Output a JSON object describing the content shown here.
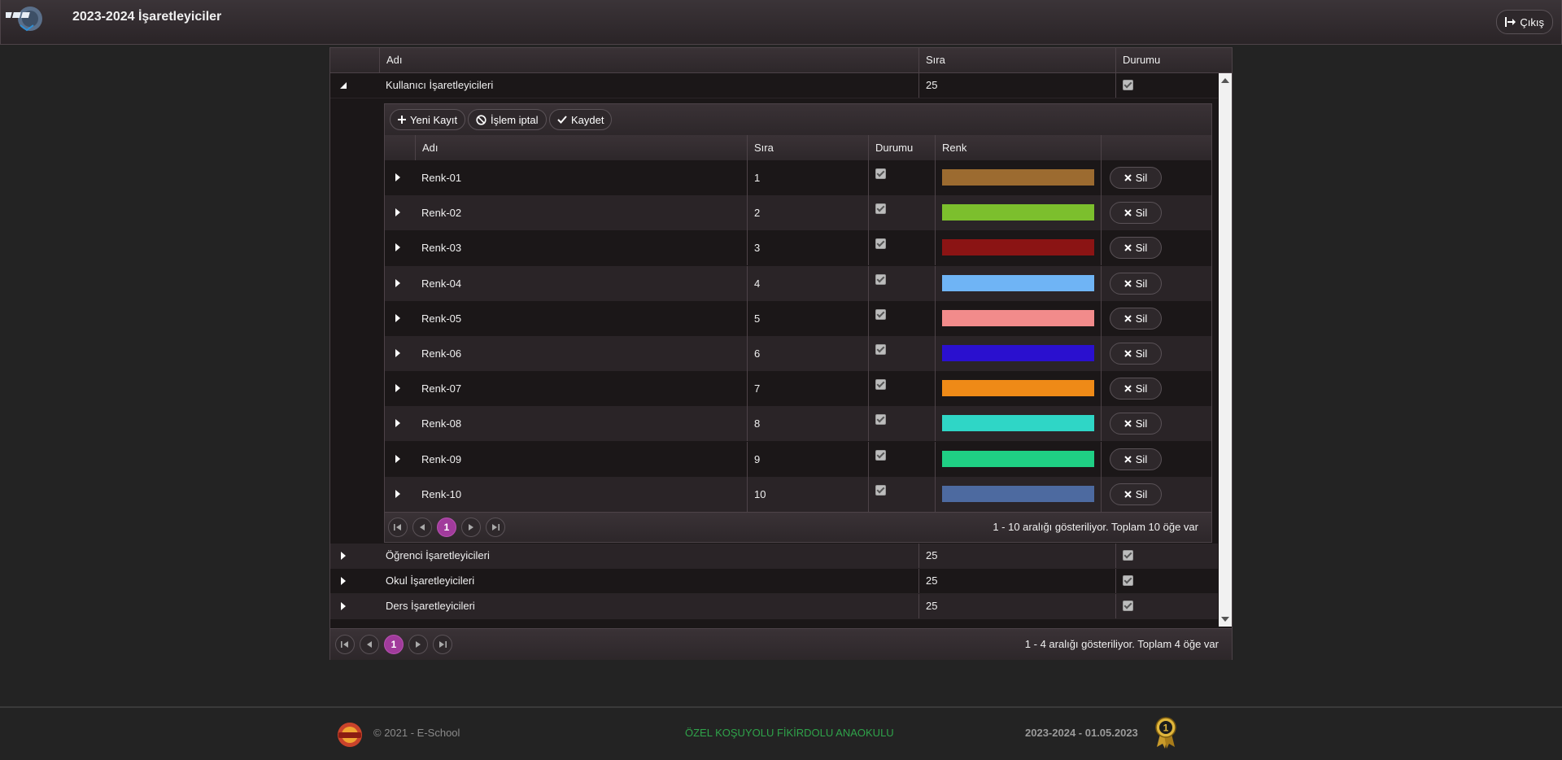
{
  "header": {
    "title": "2023-2024 İşaretleyiciler",
    "exit_label": "Çıkış"
  },
  "grid": {
    "columns": {
      "name": "Adı",
      "order": "Sıra",
      "status": "Durumu"
    },
    "rows": [
      {
        "name": "Kullanıcı İşaretleyicileri",
        "order": "25",
        "active": true,
        "expanded": true
      },
      {
        "name": "Öğrenci İşaretleyicileri",
        "order": "25",
        "active": true,
        "expanded": false
      },
      {
        "name": "Okul İşaretleyicileri",
        "order": "25",
        "active": true,
        "expanded": false
      },
      {
        "name": "Ders İşaretleyicileri",
        "order": "25",
        "active": true,
        "expanded": false
      }
    ],
    "pager": {
      "current": "1",
      "info": "1 - 4 aralığı gösteriliyor. Toplam 4 öğe var"
    }
  },
  "detail": {
    "toolbar": {
      "new_label": "Yeni Kayıt",
      "cancel_label": "İşlem iptal",
      "save_label": "Kaydet"
    },
    "columns": {
      "name": "Adı",
      "order": "Sıra",
      "status": "Durumu",
      "color": "Renk"
    },
    "delete_label": "Sil",
    "rows": [
      {
        "name": "Renk-01",
        "order": "1",
        "active": true,
        "color": "#9c6b30"
      },
      {
        "name": "Renk-02",
        "order": "2",
        "active": true,
        "color": "#7cbf2d"
      },
      {
        "name": "Renk-03",
        "order": "3",
        "active": true,
        "color": "#8b1414"
      },
      {
        "name": "Renk-04",
        "order": "4",
        "active": true,
        "color": "#6fb4f5"
      },
      {
        "name": "Renk-05",
        "order": "5",
        "active": true,
        "color": "#f28b8b"
      },
      {
        "name": "Renk-06",
        "order": "6",
        "active": true,
        "color": "#2a10cf"
      },
      {
        "name": "Renk-07",
        "order": "7",
        "active": true,
        "color": "#ef8a17"
      },
      {
        "name": "Renk-08",
        "order": "8",
        "active": true,
        "color": "#2fd6c6"
      },
      {
        "name": "Renk-09",
        "order": "9",
        "active": true,
        "color": "#1fcf84"
      },
      {
        "name": "Renk-10",
        "order": "10",
        "active": true,
        "color": "#4d6aa0"
      }
    ],
    "pager": {
      "current": "1",
      "info": "1 - 10 aralığı gösteriliyor. Toplam 10 öğe var"
    }
  },
  "footer": {
    "copyright": "© 2021 - E-School",
    "school": "ÖZEL KOŞUYOLU FİKİRDOLU ANAOKULU",
    "date": "2023-2024 - 01.05.2023"
  },
  "colors": {
    "accent": "#a13b9c",
    "background": "#232323",
    "school_green": "#2fa34a"
  }
}
